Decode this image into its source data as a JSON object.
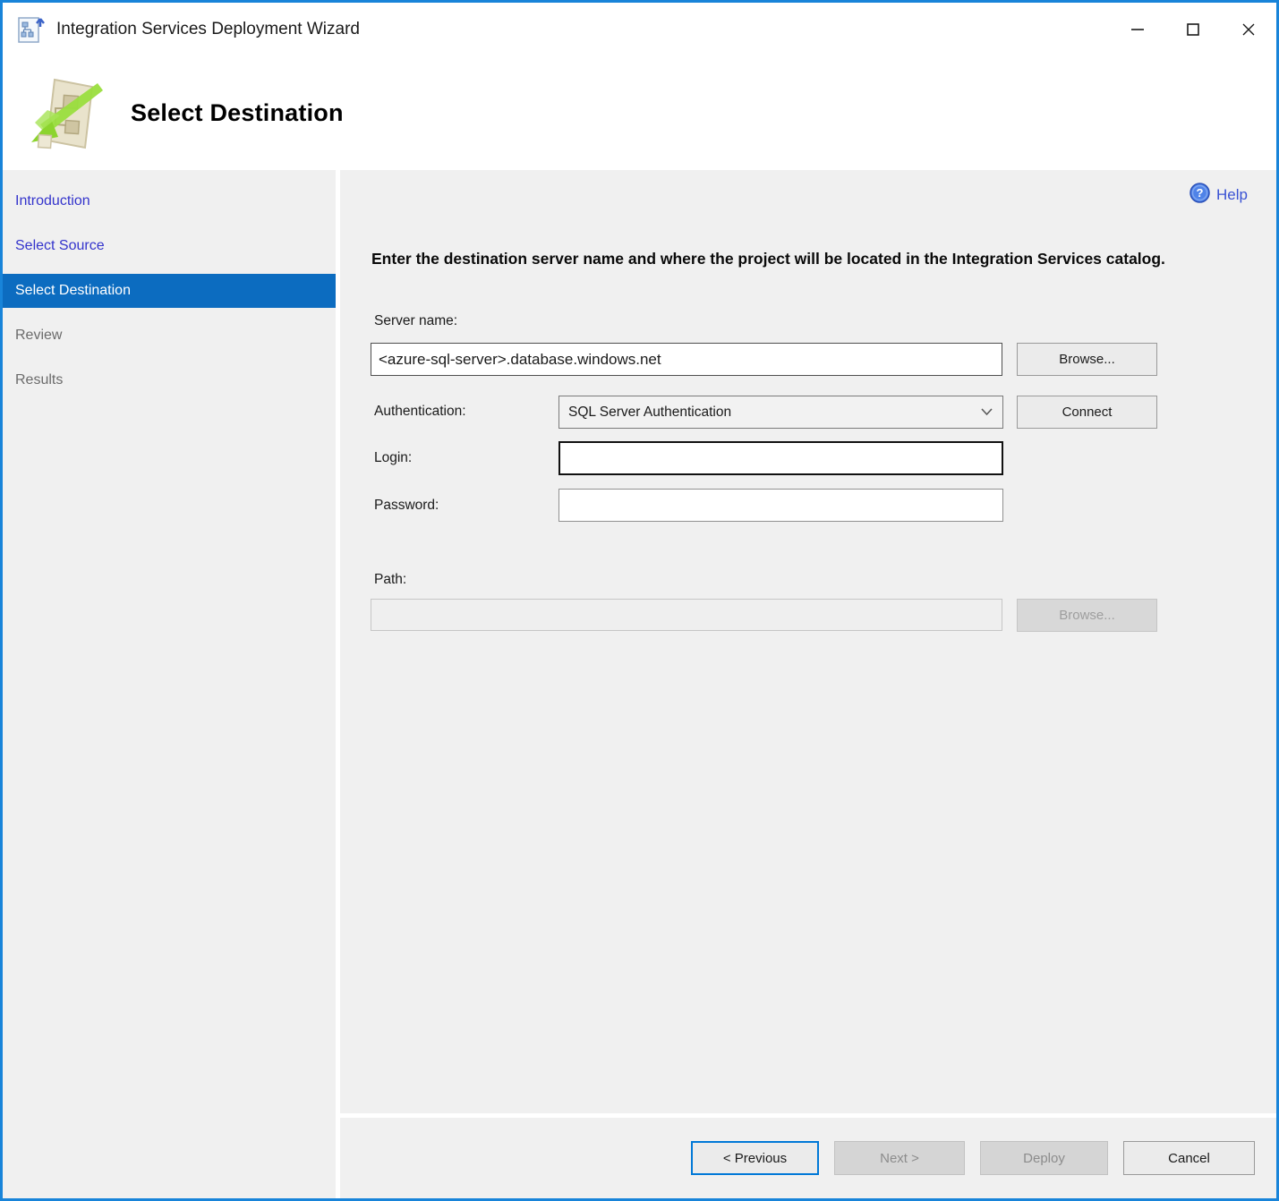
{
  "window": {
    "title": "Integration Services Deployment Wizard"
  },
  "header": {
    "title": "Select Destination"
  },
  "sidebar": {
    "items": [
      {
        "label": "Introduction",
        "state": "visited"
      },
      {
        "label": "Select Source",
        "state": "visited"
      },
      {
        "label": "Select Destination",
        "state": "active"
      },
      {
        "label": "Review",
        "state": "upcoming"
      },
      {
        "label": "Results",
        "state": "upcoming"
      }
    ]
  },
  "main": {
    "help_label": "Help",
    "instruction": "Enter the destination server name and where the project will be located in the Integration Services catalog.",
    "fields": {
      "server_name": {
        "label": "Server name:",
        "value": "<azure-sql-server>.database.windows.net"
      },
      "authentication": {
        "label": "Authentication:",
        "value": "SQL Server Authentication"
      },
      "login": {
        "label": "Login:",
        "value": ""
      },
      "password": {
        "label": "Password:",
        "value": ""
      },
      "path": {
        "label": "Path:",
        "value": ""
      }
    },
    "buttons": {
      "browse_server": "Browse...",
      "connect": "Connect",
      "browse_path": "Browse..."
    }
  },
  "footer": {
    "previous": "< Previous",
    "next": "Next >",
    "deploy": "Deploy",
    "cancel": "Cancel"
  },
  "colors": {
    "window_border": "#1884D9",
    "active_step_blue": "#0C6CC0",
    "visited_link_blue": "#3434CC",
    "help_link_blue": "#3A52D4",
    "focus_border_blue": "#0078D7",
    "background_gray": "#F0F0F0"
  }
}
